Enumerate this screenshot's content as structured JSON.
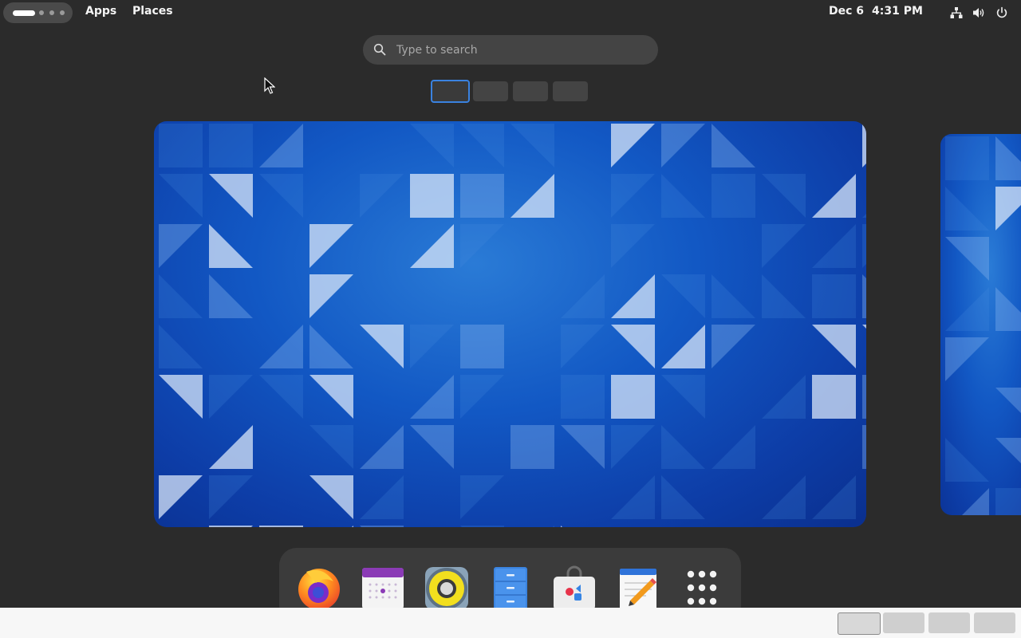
{
  "topbar": {
    "apps_label": "Apps",
    "places_label": "Places",
    "date": "Dec 6",
    "time": "4:31 PM",
    "tray_icons": [
      "network-icon",
      "volume-icon",
      "power-icon"
    ]
  },
  "search": {
    "placeholder": "Type to search"
  },
  "workspaces": {
    "count": 4,
    "active_index": 0
  },
  "dock": {
    "items": [
      {
        "name": "Firefox",
        "icon": "firefox-icon"
      },
      {
        "name": "Calendar",
        "icon": "calendar-icon"
      },
      {
        "name": "Rhythmbox",
        "icon": "speaker-icon"
      },
      {
        "name": "Files",
        "icon": "file-cabinet-icon"
      },
      {
        "name": "Software",
        "icon": "shopping-bag-icon"
      },
      {
        "name": "Text Editor",
        "icon": "notepad-pencil-icon"
      },
      {
        "name": "Show Apps",
        "icon": "app-grid-icon"
      }
    ]
  },
  "colors": {
    "accent": "#3a82e0",
    "wallpaper": "#1258c4",
    "panel": "#2b2b2b"
  }
}
